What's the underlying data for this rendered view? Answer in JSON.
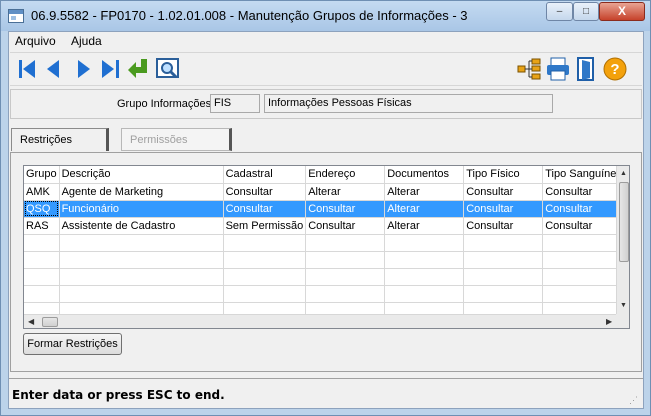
{
  "window": {
    "title": "06.9.5582 - FP0170 - 1.02.01.008 - Manutenção Grupos de Informações - 3",
    "minimize_glyph": "–",
    "maximize_glyph": "□",
    "close_glyph": "X"
  },
  "menu": {
    "items": [
      "Arquivo",
      "Ajuda"
    ]
  },
  "toolbar": {
    "left_icons": [
      "first-record-icon",
      "previous-record-icon",
      "next-record-icon",
      "last-record-icon",
      "return-icon",
      "zoom-search-icon"
    ],
    "right_icons": [
      "tree-structure-icon",
      "print-icon",
      "exit-door-icon",
      "help-icon"
    ],
    "help_glyph": "?"
  },
  "group_info": {
    "label": "Grupo Informações:",
    "code": "FIS",
    "description": "Informações Pessoas Físicas"
  },
  "tabs": [
    {
      "label": "Restrições",
      "active": true
    },
    {
      "label": "Permissões",
      "active": false
    }
  ],
  "grid": {
    "columns": [
      "Grupo",
      "Descrição",
      "Cadastral",
      "Endereço",
      "Documentos",
      "Tipo Físico",
      "Tipo Sanguíneo"
    ],
    "rows": [
      [
        "AMK",
        "Agente de Marketing",
        "Consultar",
        "Alterar",
        "Alterar",
        "Consultar",
        "Consultar"
      ],
      [
        "QSQ",
        "Funcionário",
        "Consultar",
        "Consultar",
        "Alterar",
        "Consultar",
        "Consultar"
      ],
      [
        "RAS",
        "Assistente de Cadastro",
        "Sem Permissão",
        "Consultar",
        "Alterar",
        "Consultar",
        "Consultar"
      ]
    ],
    "selected_row": 1,
    "empty_rows": 5
  },
  "buttons": {
    "form_restrictions": "Formar Restrições"
  },
  "status": {
    "message": "Enter data or press ESC to end."
  },
  "colors": {
    "selection": "#3399ff",
    "titlebar": "#b9d1ea",
    "nav_arrow": "#1f6fd1",
    "return_arrow": "#4a9a1f",
    "help": "#f3a10c"
  }
}
